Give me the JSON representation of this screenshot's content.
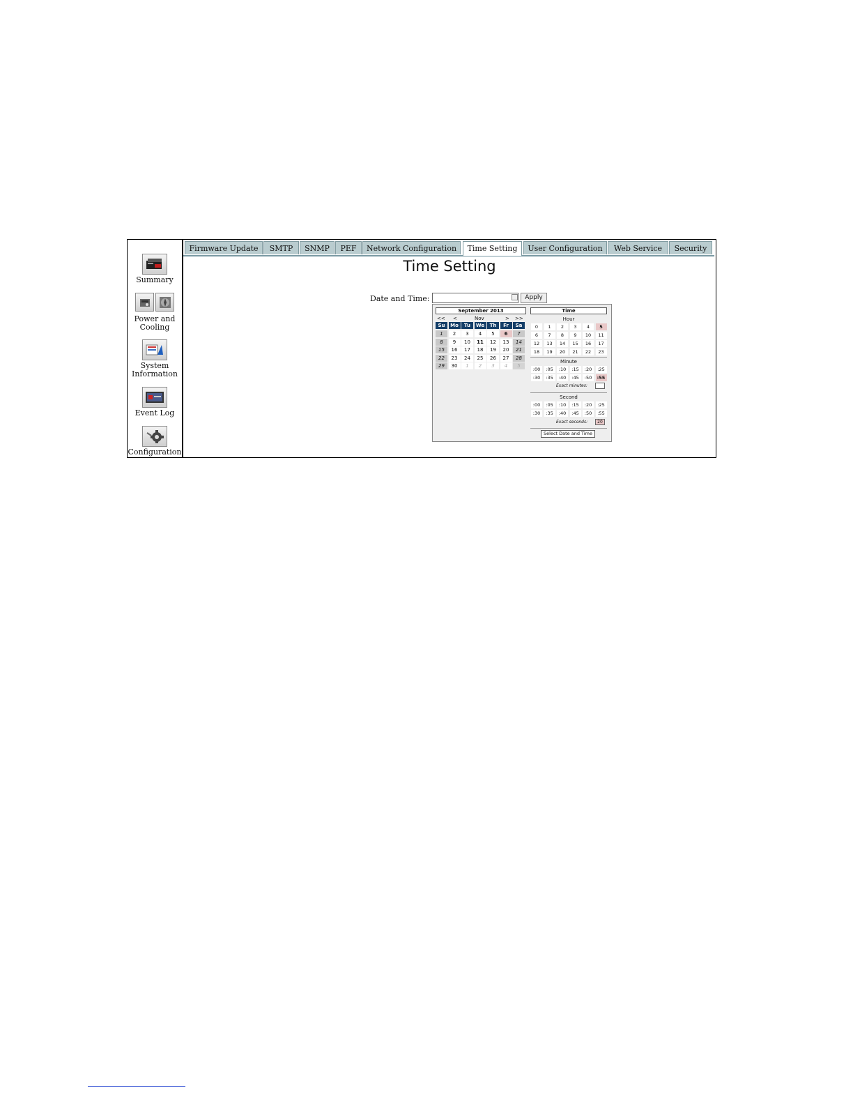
{
  "sidebar": {
    "items": [
      {
        "label": "Summary",
        "icon": "server-icon"
      },
      {
        "label_line1": "Power and",
        "label_line2": "Cooling",
        "icon": "power-icon"
      },
      {
        "label_line1": "System",
        "label_line2": "Information",
        "icon": "system-info-icon"
      },
      {
        "label": "Event Log",
        "icon": "event-log-icon"
      },
      {
        "label": "Configuration",
        "icon": "configuration-gear-icon"
      }
    ]
  },
  "tabs": [
    {
      "label": "Firmware Update"
    },
    {
      "label": "SMTP"
    },
    {
      "label": "SNMP"
    },
    {
      "label": "PEF"
    },
    {
      "label": "Network Configuration"
    },
    {
      "label": "Time Setting",
      "active": true
    },
    {
      "label": "User Configuration"
    },
    {
      "label": "Web Service"
    },
    {
      "label": "Security"
    }
  ],
  "page": {
    "title": "Time Setting",
    "date_label": "Date and Time:",
    "date_value": "",
    "apply_label": "Apply"
  },
  "calendar": {
    "month_title": "September 2013",
    "nav": {
      "prev_year": "<<",
      "prev": "<",
      "month": "Nov",
      "next": ">",
      "next_year": ">>"
    },
    "weekdays": [
      "Su",
      "Mo",
      "Tu",
      "We",
      "Th",
      "Fr",
      "Sa"
    ],
    "weeks": [
      [
        "1",
        "2",
        "3",
        "4",
        "5",
        "6",
        "7"
      ],
      [
        "8",
        "9",
        "10",
        "11",
        "12",
        "13",
        "14"
      ],
      [
        "15",
        "16",
        "17",
        "18",
        "19",
        "20",
        "21"
      ],
      [
        "22",
        "23",
        "24",
        "25",
        "26",
        "27",
        "28"
      ],
      [
        "29",
        "30",
        "1",
        "2",
        "3",
        "4",
        "5"
      ]
    ],
    "today": "6",
    "highlighted": "11",
    "time_title": "Time",
    "hour_label": "Hour",
    "hours": [
      "0",
      "1",
      "2",
      "3",
      "4",
      "5",
      "6",
      "7",
      "8",
      "9",
      "10",
      "11",
      "12",
      "13",
      "14",
      "15",
      "16",
      "17",
      "18",
      "19",
      "20",
      "21",
      "22",
      "23"
    ],
    "selected_hour": "5",
    "minute_label": "Minute",
    "minutes": [
      ":00",
      ":05",
      ":10",
      ":15",
      ":20",
      ":25",
      ":30",
      ":35",
      ":40",
      ":45",
      ":50",
      ":55"
    ],
    "selected_minute": ":55",
    "exact_minutes_label": "Exact minutes:",
    "exact_minutes_value": "",
    "second_label": "Second",
    "seconds": [
      ":00",
      ":05",
      ":10",
      ":15",
      ":20",
      ":25",
      ":30",
      ":35",
      ":40",
      ":45",
      ":50",
      ":55"
    ],
    "exact_seconds_label": "Exact seconds:",
    "exact_seconds_value": "20",
    "select_button_label": "Select Date and Time"
  },
  "colors": {
    "tab_bg": "#b9cccf",
    "calendar_header": "#143e68",
    "selected": "#e9c8c8"
  }
}
